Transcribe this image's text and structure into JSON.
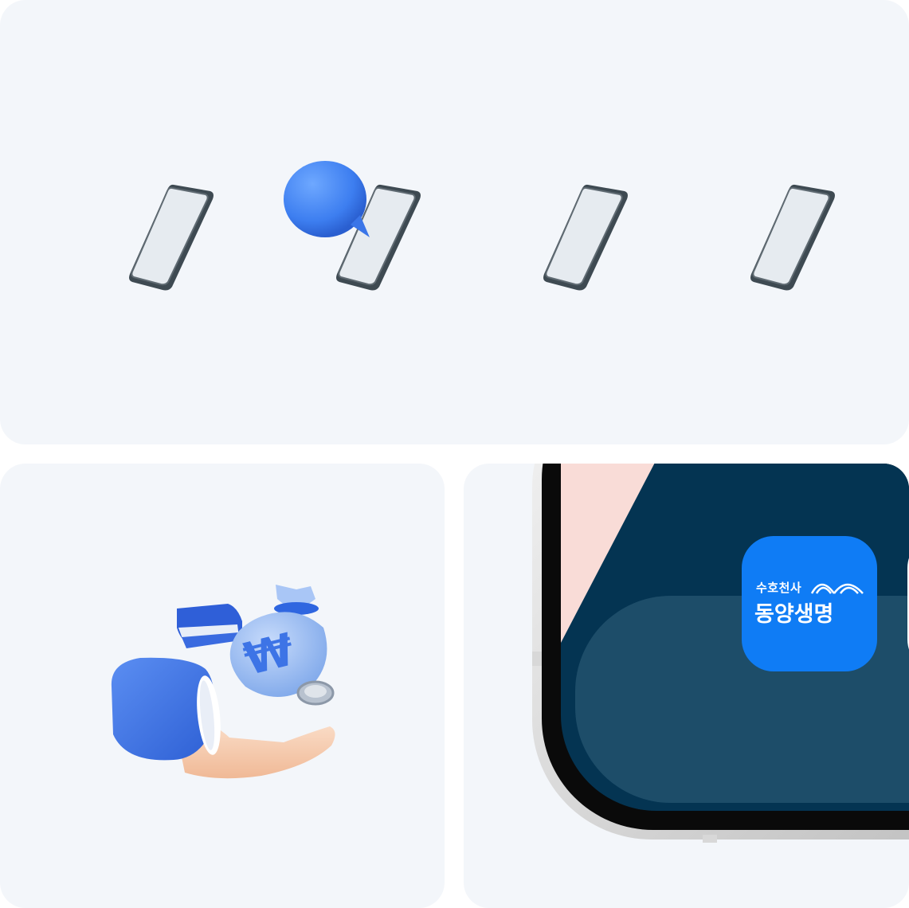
{
  "top_card": {
    "illustrations": [
      {
        "name": "phone-1",
        "has_chat_bubble": false
      },
      {
        "name": "phone-2",
        "has_chat_bubble": true
      },
      {
        "name": "phone-3",
        "has_chat_bubble": false
      },
      {
        "name": "phone-4",
        "has_chat_bubble": false
      }
    ]
  },
  "bottom_left_card": {
    "illustration": "hand-receiving-money-bag",
    "currency_symbol": "₩"
  },
  "bottom_right_card": {
    "dock_apps": [
      {
        "name": "dongyang-life",
        "subtitle": "수호천사",
        "title": "동양생명"
      },
      {
        "name": "safari",
        "icon": "compass-icon"
      }
    ]
  },
  "colors": {
    "card_bg": "#f3f6fa",
    "accent_blue": "#3d7ef0",
    "app_blue": "#0f7cf5",
    "dock": "#1d4d69",
    "wallpaper_dark": "#043452",
    "wallpaper_pink": "#f9dcd7"
  }
}
